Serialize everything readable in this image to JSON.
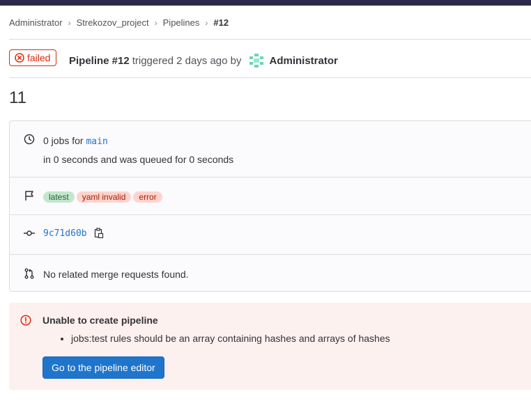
{
  "breadcrumb": {
    "items": [
      "Administrator",
      "Strekozov_project",
      "Pipelines"
    ],
    "current": "#12"
  },
  "pipeline": {
    "status": "failed",
    "id_label": "Pipeline #12",
    "triggered_text": "triggered 2 days ago by",
    "user": "Administrator",
    "title": "11"
  },
  "info": {
    "jobs_prefix": "0 jobs for",
    "branch": "main",
    "duration": "in 0 seconds and was queued for 0 seconds",
    "badges": [
      "latest",
      "yaml invalid",
      "error"
    ],
    "commit_sha": "9c71d60b",
    "merge_requests": "No related merge requests found."
  },
  "alert": {
    "title": "Unable to create pipeline",
    "message": "jobs:test rules should be an array containing hashes and arrays of hashes",
    "button_label": "Go to the pipeline editor"
  },
  "colors": {
    "danger": "#dd2b0e",
    "link": "#1f75cb",
    "topbar": "#2b2a4a"
  }
}
